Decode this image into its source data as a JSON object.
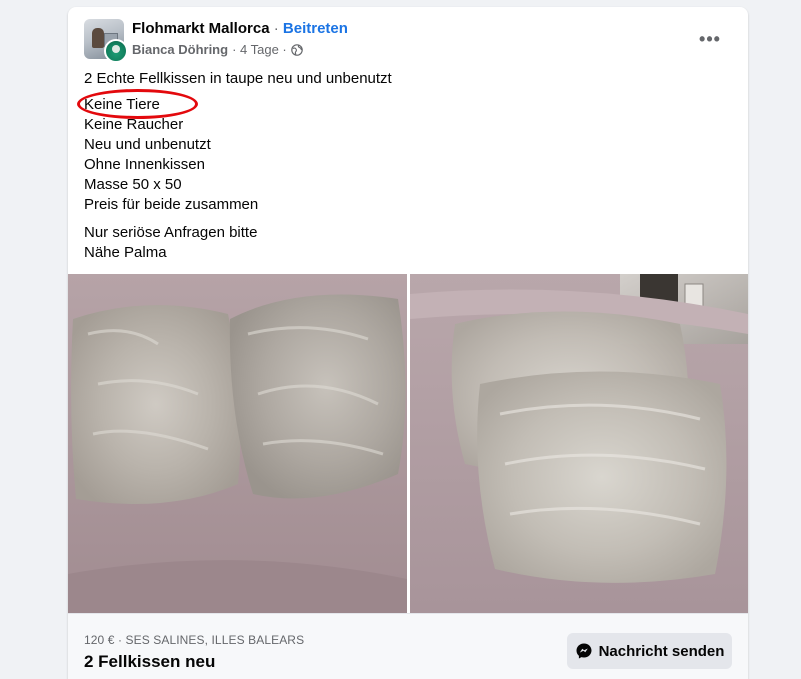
{
  "post": {
    "group_name": "Flohmarkt Mallorca",
    "separator": " · ",
    "join_label": "Beitreten",
    "author": "Bianca Döhring",
    "time": "· 4 Tage ·",
    "more_label": "•••",
    "lines": [
      "2 Echte Fellkissen in taupe neu und unbenutzt",
      "Keine Tiere",
      "Keine Raucher",
      "Neu und unbenutzt",
      "Ohne Innenkissen",
      "Masse 50 x 50",
      "Preis für beide zusammen",
      "Nur seriöse Anfragen bitte",
      "Nähe Palma"
    ]
  },
  "icons": {
    "avatar": "group-avatar",
    "globe": "globe-icon",
    "more": "more-options-icon",
    "messenger": "messenger-icon"
  },
  "listing": {
    "price_location": "120 € · SES SALINES, ILLES BALEARS",
    "title": "2 Fellkissen neu",
    "message_button": "Nachricht senden"
  },
  "colors": {
    "link": "#1b74e4",
    "annotation": "#e3090d",
    "secondary_text": "#65676b"
  }
}
